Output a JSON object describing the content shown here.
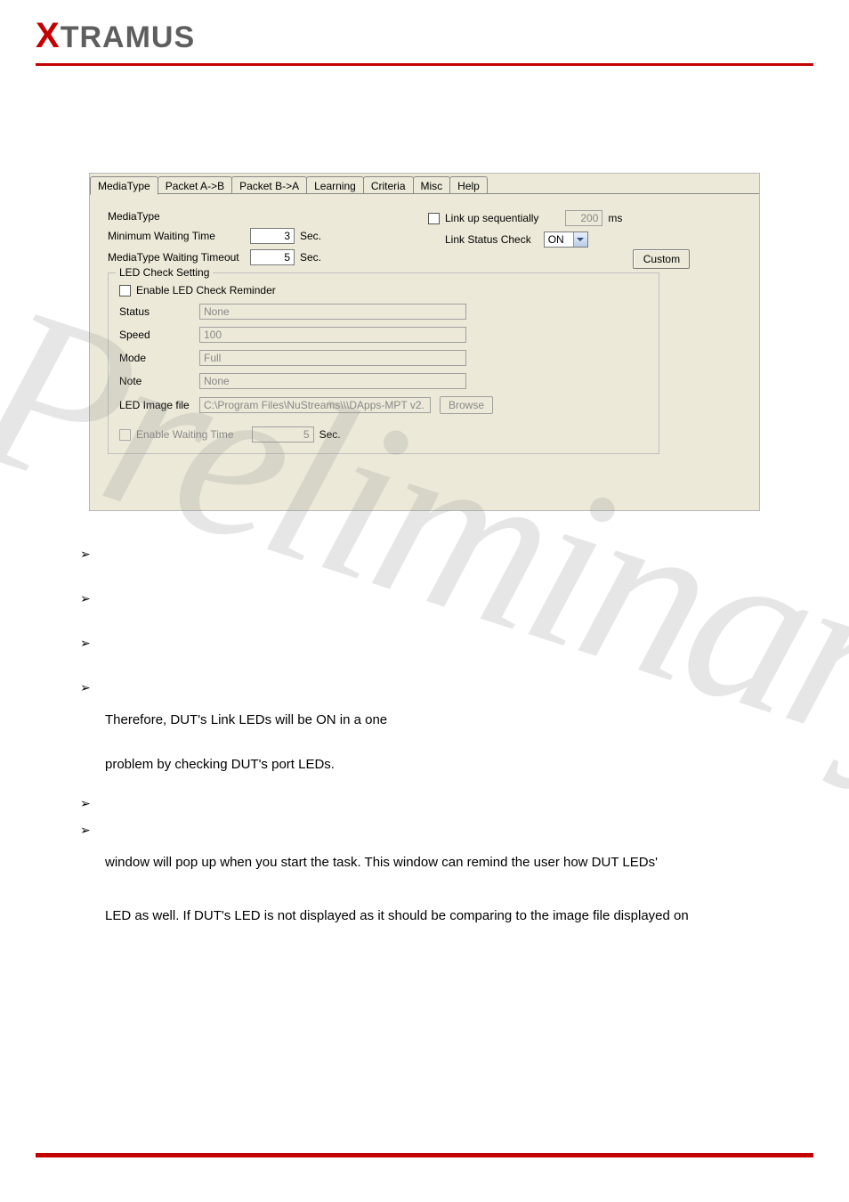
{
  "logo": {
    "prefix": "X",
    "rest": "TRAMUS"
  },
  "tabs": [
    "MediaType",
    "Packet A->B",
    "Packet B->A",
    "Learning",
    "Criteria",
    "Misc",
    "Help"
  ],
  "panel": {
    "mediaTypeLabel": "MediaType",
    "linkUpSeqLabel": "Link up sequentially",
    "msValue": "200",
    "msUnit": "ms",
    "minWaitLabel": "Minimum Waiting Time",
    "minWaitValue": "3",
    "secUnit": "Sec.",
    "linkStatusLabel": "Link Status Check",
    "linkStatusValue": "ON",
    "mediaTypeTimeoutLabel": "MediaType Waiting Timeout",
    "mediaTypeTimeoutValue": "5",
    "customBtn": "Custom",
    "ledLegend": "LED Check Setting",
    "enableLedReminder": "Enable LED Check Reminder",
    "statusLabel": "Status",
    "statusValue": "None",
    "speedLabel": "Speed",
    "speedValue": "100",
    "modeLabel": "Mode",
    "modeValue": "Full",
    "noteLabel": "Note",
    "noteValue": "None",
    "ledImgLabel": "LED Image file",
    "ledImgValue": "C:\\Program Files\\NuStreams\\\\\\DApps-MPT v2.",
    "browseBtn": "Browse",
    "enableWaitingLabel": "Enable Waiting Time",
    "enableWaitingValue": "5"
  },
  "watermark": "Preliminary",
  "body": {
    "p1": "Therefore, DUT's Link LEDs will be ON in a one",
    "p2": "problem by checking DUT's port LEDs.",
    "p3": "window will pop up when you start the task. This window can remind the user how DUT LEDs'",
    "p4": "LED as well. If DUT's LED is not displayed as it should be comparing to the image file displayed on"
  }
}
